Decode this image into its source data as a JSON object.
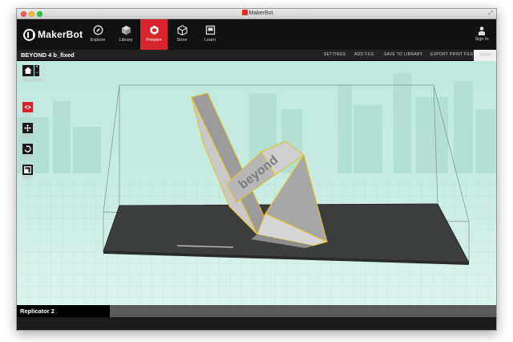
{
  "window": {
    "title": "MakerBot"
  },
  "brand": {
    "name": "MakerBot",
    "accent": "#d8242b"
  },
  "nav": {
    "items": [
      {
        "label": "Explore",
        "icon": "compass-icon"
      },
      {
        "label": "Library",
        "icon": "library-icon"
      },
      {
        "label": "Prepare",
        "icon": "prepare-icon",
        "active": true
      },
      {
        "label": "Store",
        "icon": "store-icon"
      },
      {
        "label": "Learn",
        "icon": "learn-icon"
      }
    ],
    "signin": "Sign In"
  },
  "toolbar": {
    "file_name": "BEYOND 4 b_fixed",
    "settings": "SETTINGS",
    "add_file": "ADD FILE",
    "save_to_library": "SAVE TO LIBRARY",
    "export_print_file": "EXPORT PRINT FILE",
    "print": "PRINT"
  },
  "tools": {
    "home_view": "Home View",
    "zoom_in": "+",
    "zoom_out": "−",
    "view": "View",
    "move": "Move",
    "turn": "Turn",
    "scale": "Scale"
  },
  "model": {
    "text": "beyond"
  },
  "status": {
    "machine": "Replicator 2"
  }
}
